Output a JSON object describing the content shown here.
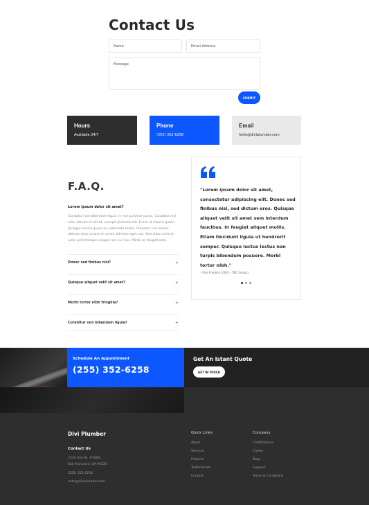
{
  "contact": {
    "title": "Contact Us",
    "name_placeholder": "Name",
    "email_placeholder": "Email Address",
    "message_placeholder": "Message",
    "submit_label": "SUBMIT"
  },
  "info_boxes": {
    "hours": {
      "title": "Hours",
      "text": "Available 24/7"
    },
    "phone": {
      "title": "Phone",
      "text": "(255) 352-6258"
    },
    "email": {
      "title": "Email",
      "text": "hello@diviplumber.com"
    }
  },
  "faq": {
    "title": "F.A.Q.",
    "open_question": "Lorem ipsum dolor sit amet?",
    "open_answer": "Curabitur non bibendum ligula. In non pulvinar purus. Curabitur nisi odio, blandit et elit at, suscipit pharetra elit. Fusce ut mauris quam. Quisque lacinia quam eu commodo mollis. Praesent nisl massa, ultrices vitae ornare sit amet, ultricies eget orci. Sed vitae nulla et justo pellentesque congue nec eu risus. Morbi ac feugiat ante.",
    "items": [
      "Donec sed finibus nisi?",
      "Quisque aliquet velit sit amet?",
      "Morbi tortor nibh fringilla?",
      "Curabitur non bibendum ligula?"
    ],
    "plus": "+"
  },
  "testimonial": {
    "quote": "\"Lorem ipsum dolor sit amet, consectetur adipiscing elit. Donec sed finibus nisi, sed dictum eros. Quisque aliquet velit sit amet sem interdum faucibus. In feugiat aliquet mollis. Etiam tincidunt ligula ut hendrerit semper. Quisque luctus lectus non turpis bibendum posuere. Morbi tortor nibh.\"",
    "author": "– Ran Franklin (CEO – TBC Group)"
  },
  "banner": {
    "schedule_label": "Schedule An Appointment",
    "phone": "(255) 352-6258",
    "quote_title": "Get An Istant Quote",
    "cta_label": "GET IN TOUCH"
  },
  "footer": {
    "brand": "Divi Plumber",
    "contact_heading": "Contact Us",
    "address_line1": "1234 Divi St. #1000,",
    "address_line2": "San Francisco, CA 94220",
    "phone": "(255) 352-6258",
    "email": "hello@diviplumber.com",
    "quick_links_heading": "Quick Links",
    "quick_links": [
      "About",
      "Services",
      "Projects",
      "Testimonials",
      "Contact"
    ],
    "company_heading": "Company",
    "company_links": [
      "Certifications",
      "Career",
      "Blog",
      "Support",
      "Terms & Conditions"
    ]
  },
  "colors": {
    "accent": "#0c57ff",
    "dark": "#2e2e2e",
    "light_box": "#e9e9e9"
  }
}
